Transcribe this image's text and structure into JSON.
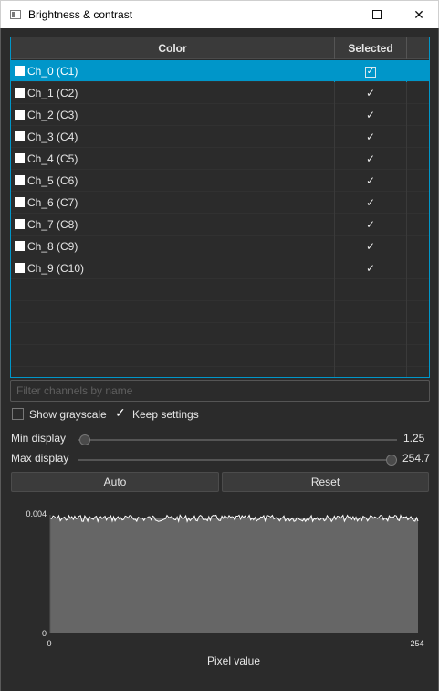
{
  "window": {
    "title": "Brightness & contrast",
    "minimize_glyph": "—",
    "close_glyph": "✕"
  },
  "table": {
    "headers": {
      "color": "Color",
      "selected": "Selected"
    },
    "rows": [
      {
        "label": "Ch_0 (C1)",
        "swatch": "#ffffff",
        "selected": true,
        "highlighted": true
      },
      {
        "label": "Ch_1 (C2)",
        "swatch": "#ffffff",
        "selected": true
      },
      {
        "label": "Ch_2 (C3)",
        "swatch": "#ffffff",
        "selected": true
      },
      {
        "label": "Ch_3 (C4)",
        "swatch": "#ffffff",
        "selected": true
      },
      {
        "label": "Ch_4 (C5)",
        "swatch": "#ffffff",
        "selected": true
      },
      {
        "label": "Ch_5 (C6)",
        "swatch": "#ffffff",
        "selected": true
      },
      {
        "label": "Ch_6 (C7)",
        "swatch": "#ffffff",
        "selected": true
      },
      {
        "label": "Ch_7 (C8)",
        "swatch": "#ffffff",
        "selected": true
      },
      {
        "label": "Ch_8 (C9)",
        "swatch": "#ffffff",
        "selected": true
      },
      {
        "label": "Ch_9 (C10)",
        "swatch": "#ffffff",
        "selected": true
      }
    ],
    "empty_rows": 5,
    "check_glyph": "✓",
    "highlight_color": "#0096c9"
  },
  "filter": {
    "placeholder": "Filter channels by name",
    "value": ""
  },
  "options": {
    "show_grayscale": {
      "label": "Show grayscale",
      "checked": false
    },
    "keep_settings": {
      "label": "Keep settings",
      "checked": true,
      "glyph": "✓"
    }
  },
  "min_display": {
    "label": "Min display",
    "value": "1.25",
    "position_fraction": 0.005
  },
  "max_display": {
    "label": "Max display",
    "value": "254.7",
    "position_fraction": 1.0
  },
  "buttons": {
    "auto": "Auto",
    "reset": "Reset"
  },
  "histogram": {
    "y_max_label": "0.004",
    "y_min_label": "0",
    "x_min_label": "0",
    "x_max_label": "254",
    "x_axis_label": "Pixel value",
    "fill_color": "#666666",
    "line_color": "#ffffff",
    "level_fraction": 0.97
  }
}
